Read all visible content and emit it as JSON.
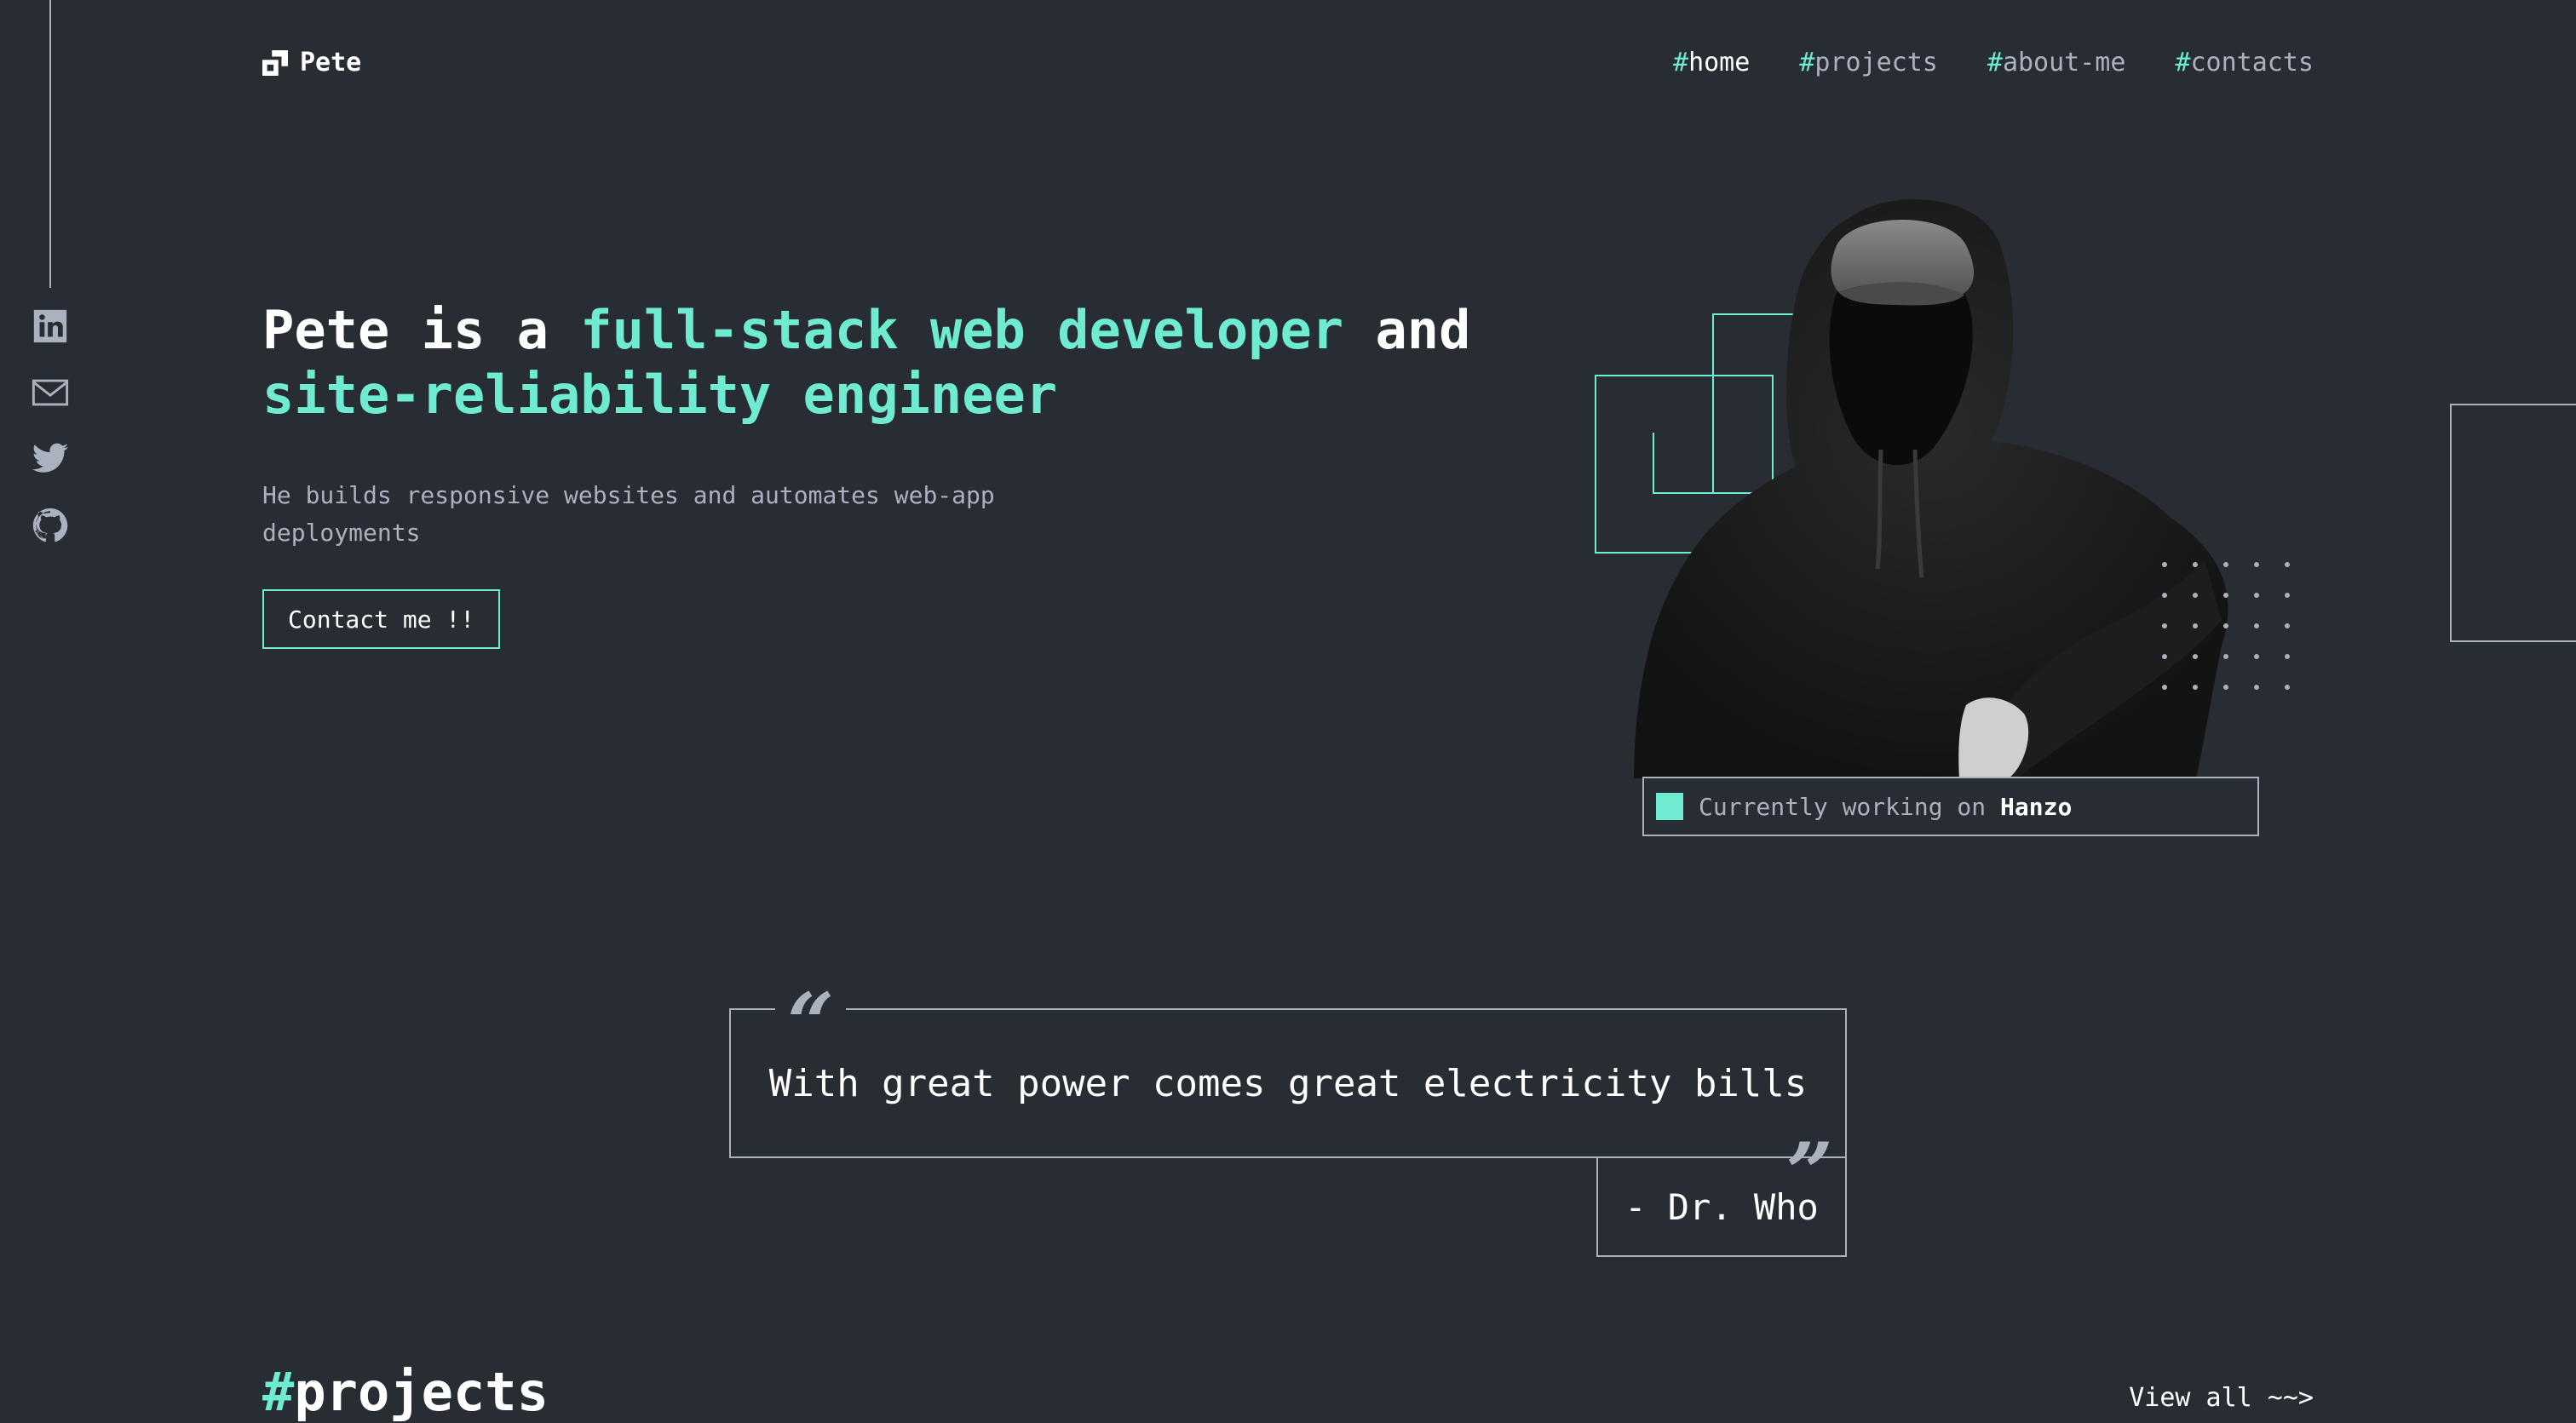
{
  "header": {
    "logo_text": "Pete",
    "logo_icon": "logo-icon",
    "nav": [
      {
        "hash": "#",
        "label": "home",
        "active": true
      },
      {
        "hash": "#",
        "label": "projects",
        "active": false
      },
      {
        "hash": "#",
        "label": "about-me",
        "active": false
      },
      {
        "hash": "#",
        "label": "contacts",
        "active": false
      }
    ]
  },
  "sidebar": {
    "socials": [
      "linkedin-icon",
      "mail-icon",
      "twitter-icon",
      "github-icon"
    ]
  },
  "hero": {
    "title_part1": "Pete is a ",
    "title_accent1": "full-stack web developer",
    "title_part2": " and ",
    "title_accent2": "site-reliability engineer",
    "subtitle": "He builds responsive websites and automates web-app deployments",
    "cta_label": "Contact me !!"
  },
  "status": {
    "prefix": "Currently working on ",
    "project": "Hanzo"
  },
  "quote": {
    "open_mark": "“",
    "close_mark": "”",
    "text": "With great power comes great electricity bills",
    "author": "- Dr. Who"
  },
  "projects_section": {
    "hash": "#",
    "title": "projects",
    "view_all": "View all ~~>"
  },
  "colors": {
    "background": "#282C33",
    "accent": "#6EEBD0",
    "text": "#ABB2BF",
    "white": "#FFFFFF"
  }
}
